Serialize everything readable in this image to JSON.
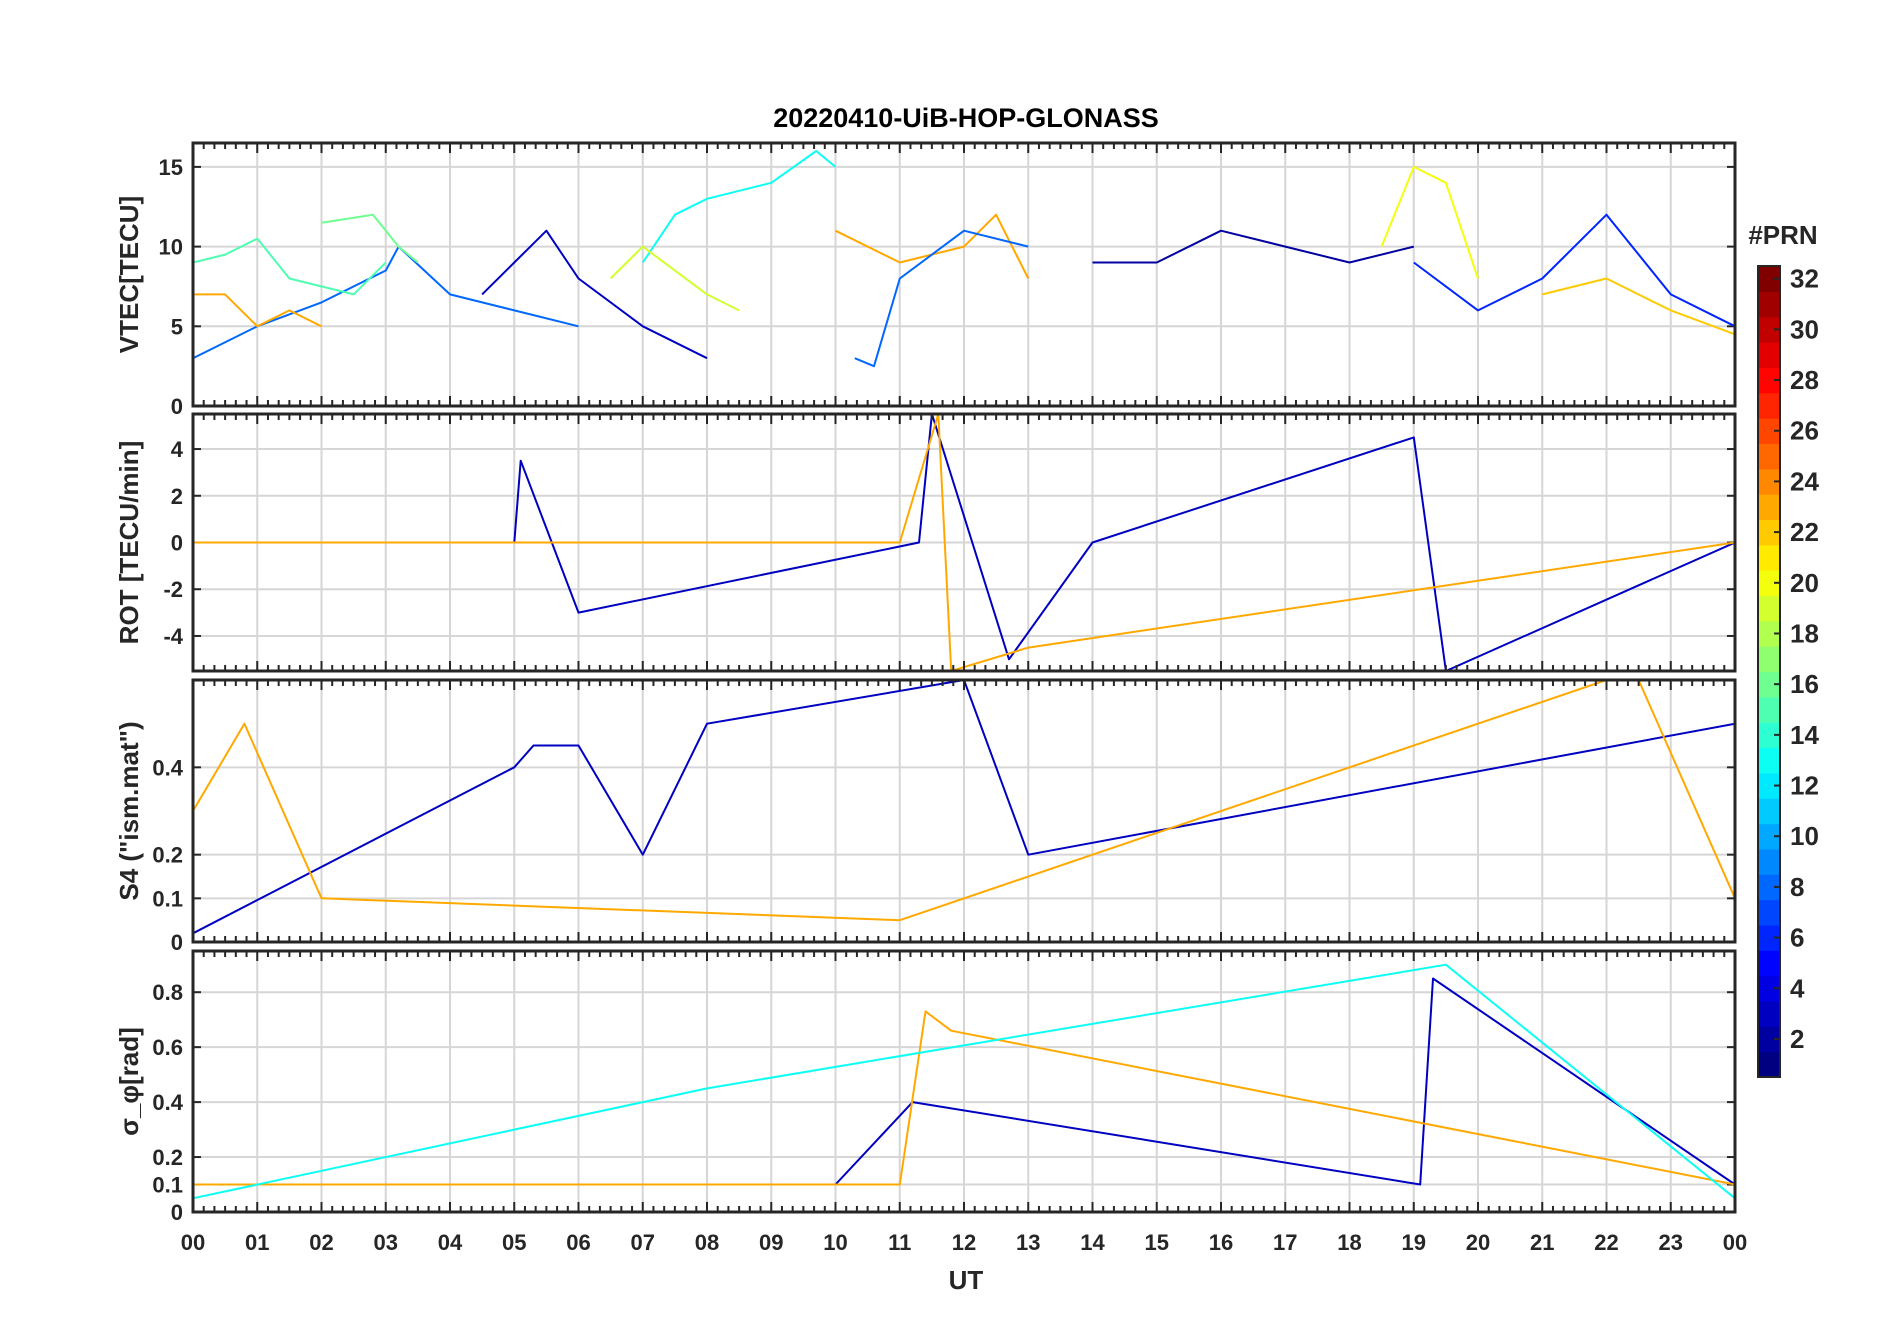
{
  "figure": {
    "title": "20220410-UiB-HOP-GLONASS"
  },
  "colorbar": {
    "title": "#PRN",
    "range": [
      1,
      32
    ],
    "ticks": [
      "2",
      "4",
      "6",
      "8",
      "10",
      "12",
      "14",
      "16",
      "18",
      "20",
      "22",
      "24",
      "26",
      "28",
      "30",
      "32"
    ],
    "colormap": "jet"
  },
  "chart_data": [
    {
      "type": "line",
      "panel": "vtec",
      "ylabel": "VTEC[TECU]",
      "ylim": [
        0,
        16.5
      ],
      "yticks": [
        "0",
        "5",
        "10",
        "15"
      ],
      "xlim": [
        0,
        24
      ],
      "xticks": [
        "00",
        "01",
        "02",
        "03",
        "04",
        "05",
        "06",
        "07",
        "08",
        "09",
        "10",
        "11",
        "12",
        "13",
        "14",
        "15",
        "16",
        "17",
        "18",
        "19",
        "20",
        "21",
        "22",
        "23",
        "00"
      ],
      "grid": true,
      "series": [
        {
          "prn": 8,
          "x": [
            0,
            1,
            2,
            3,
            3.2,
            4,
            5,
            6
          ],
          "values": [
            3,
            5,
            6.5,
            8.5,
            10,
            7,
            6,
            5
          ]
        },
        {
          "prn": 15,
          "x": [
            0,
            0.5,
            1,
            1.5,
            2.5,
            3
          ],
          "values": [
            9,
            9.5,
            10.5,
            8,
            7,
            9
          ]
        },
        {
          "prn": 16,
          "x": [
            2,
            2.8,
            3.2,
            3.5
          ],
          "values": [
            11.5,
            12,
            10,
            9
          ]
        },
        {
          "prn": 23,
          "x": [
            0,
            0.5,
            1,
            1.5,
            2
          ],
          "values": [
            7,
            7,
            5,
            6,
            5
          ]
        },
        {
          "prn": 3,
          "x": [
            4.5,
            5,
            5.5,
            6,
            7,
            8
          ],
          "values": [
            7,
            9,
            11,
            8,
            5,
            3
          ]
        },
        {
          "prn": 13,
          "x": [
            7,
            7.5,
            8,
            9,
            9.7,
            10
          ],
          "values": [
            9,
            12,
            13,
            14,
            16,
            15
          ]
        },
        {
          "prn": 19,
          "x": [
            6.5,
            7,
            8,
            8.5
          ],
          "values": [
            8,
            10,
            7,
            6
          ]
        },
        {
          "prn": 23,
          "x": [
            10,
            11,
            12,
            12.5,
            13
          ],
          "values": [
            11,
            9,
            10,
            12,
            8
          ]
        },
        {
          "prn": 8,
          "x": [
            10.3,
            10.6,
            11,
            12,
            13
          ],
          "values": [
            3,
            2.5,
            8,
            11,
            10
          ]
        },
        {
          "prn": 2,
          "x": [
            14,
            15,
            16,
            17,
            18,
            19
          ],
          "values": [
            9,
            9,
            11,
            10,
            9,
            10
          ]
        },
        {
          "prn": 20,
          "x": [
            18.5,
            19,
            19.5,
            20
          ],
          "values": [
            10,
            15,
            14,
            8
          ]
        },
        {
          "prn": 6,
          "x": [
            19,
            20,
            21,
            22,
            23,
            24
          ],
          "values": [
            9,
            6,
            8,
            12,
            7,
            5
          ]
        },
        {
          "prn": 22,
          "x": [
            21,
            22,
            23,
            24
          ],
          "values": [
            7,
            8,
            6,
            4.5
          ]
        }
      ]
    },
    {
      "type": "line",
      "panel": "rot",
      "ylabel": "ROT [TECU/min]",
      "ylim": [
        -5.5,
        5.5
      ],
      "yticks": [
        "-4",
        "-2",
        "0",
        "2",
        "4"
      ],
      "xlim": [
        0,
        24
      ],
      "grid": true,
      "series": [
        {
          "prn": 3,
          "x": [
            0,
            5,
            5.1,
            6,
            11.3,
            11.5,
            12.7,
            14,
            19,
            19.5,
            24
          ],
          "values": [
            0,
            0,
            3.5,
            -3,
            0,
            5.5,
            -5,
            0,
            4.5,
            -5.5,
            0
          ]
        },
        {
          "prn": 23,
          "x": [
            0,
            11,
            11.6,
            11.8,
            13,
            24
          ],
          "values": [
            0,
            0,
            5.5,
            -5.5,
            -4.5,
            0
          ]
        }
      ]
    },
    {
      "type": "line",
      "panel": "s4",
      "ylabel": "S4 (\"ism.mat\")",
      "ylim": [
        0,
        0.6
      ],
      "yticks": [
        "0",
        "0.1",
        "0.2",
        "0.4"
      ],
      "xlim": [
        0,
        24
      ],
      "grid": true,
      "series": [
        {
          "prn": 3,
          "x": [
            0,
            5,
            5.3,
            6,
            7,
            8,
            12,
            13,
            24
          ],
          "values": [
            0.02,
            0.4,
            0.45,
            0.45,
            0.2,
            0.5,
            0.6,
            0.2,
            0.5
          ]
        },
        {
          "prn": 23,
          "x": [
            0,
            0.8,
            2,
            11,
            22,
            22.5,
            24
          ],
          "values": [
            0.3,
            0.5,
            0.1,
            0.05,
            0.6,
            0.6,
            0.1
          ]
        }
      ]
    },
    {
      "type": "line",
      "panel": "sigma_phi",
      "ylabel": "σ_φ[rad]",
      "ylim": [
        0,
        0.95
      ],
      "yticks": [
        "0",
        "0.1",
        "0.2",
        "0.4",
        "0.6",
        "0.8"
      ],
      "xlim": [
        0,
        24
      ],
      "xlabel": "UT",
      "grid": true,
      "series": [
        {
          "prn": 3,
          "x": [
            0,
            10,
            11.2,
            19.1,
            19.3,
            24
          ],
          "values": [
            0.1,
            0.1,
            0.4,
            0.1,
            0.85,
            0.1
          ]
        },
        {
          "prn": 23,
          "x": [
            0,
            11,
            11.4,
            11.8,
            24
          ],
          "values": [
            0.1,
            0.1,
            0.73,
            0.66,
            0.1
          ]
        },
        {
          "prn": 13,
          "x": [
            0,
            8,
            19.5,
            24
          ],
          "values": [
            0.05,
            0.45,
            0.9,
            0.05
          ]
        }
      ]
    }
  ]
}
